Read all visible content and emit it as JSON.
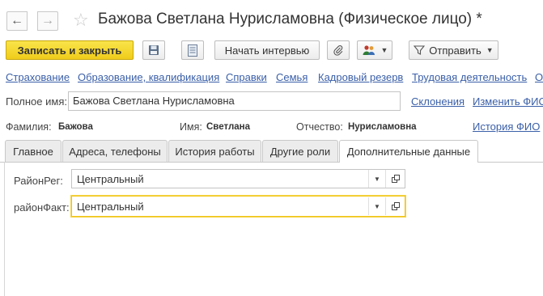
{
  "window": {
    "title": "Бажова Светлана Нурисламовна (Физическое лицо) *"
  },
  "toolbar": {
    "save_close_label": "Записать и закрыть",
    "interview_label": "Начать интервью",
    "send_label": "Отправить"
  },
  "links": [
    "Страхование",
    "Образование, квалификация",
    "Справки",
    "Семья",
    "Кадровый резерв",
    "Трудовая деятельность",
    "О"
  ],
  "fullname": {
    "label": "Полное имя:",
    "value": "Бажова Светлана Нурисламовна"
  },
  "declension_link": "Склонения",
  "change_fio_link": "Изменить ФИО",
  "history_fio_link": "История ФИО",
  "lastname": {
    "label": "Фамилия:",
    "value": "Бажова"
  },
  "firstname": {
    "label": "Имя:",
    "value": "Светлана"
  },
  "patronymic": {
    "label": "Отчество:",
    "value": "Нурисламовна"
  },
  "tabs": [
    "Главное",
    "Адреса, телефоны",
    "История работы",
    "Другие роли",
    "Дополнительные данные"
  ],
  "fields": {
    "region_reg": {
      "label": "РайонРег:",
      "value": "Центральный"
    },
    "region_fact": {
      "label": "районФакт:",
      "value": "Центральный"
    }
  },
  "colors": {
    "primary_button": "#f0cc1b",
    "link": "#3a5fa8",
    "focus_border": "#f0c419"
  }
}
